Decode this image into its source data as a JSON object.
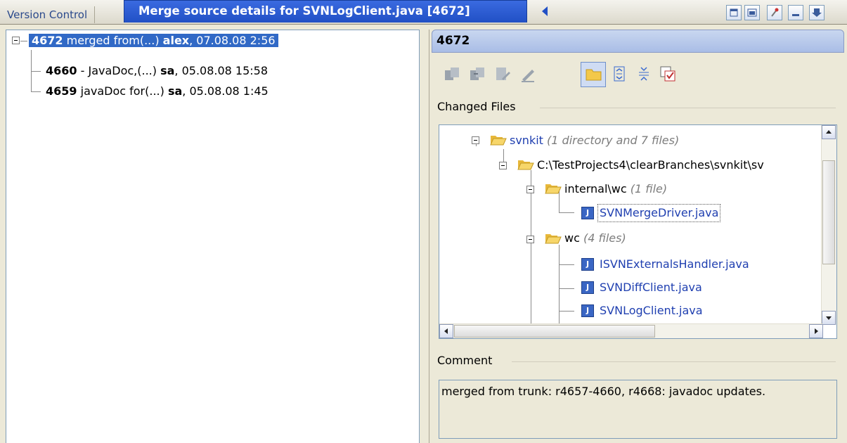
{
  "tabs": {
    "inactive_label": "Version Control",
    "active_label": "Merge source details for SVNLogClient.java [4672]"
  },
  "left_tree": {
    "root": {
      "rev": "4672",
      "msg": " merged from(...) ",
      "author": "alex",
      "date": ", 07.08.08 2:56"
    },
    "children": [
      {
        "rev": "4660",
        "msg": " - JavaDoc,(...) ",
        "author": "sa",
        "date": ", 05.08.08 15:58"
      },
      {
        "rev": "4659",
        "msg": " javaDoc for(...) ",
        "author": "sa",
        "date": ", 05.08.08 1:45"
      }
    ]
  },
  "details": {
    "header": "4672",
    "changed_files_label": "Changed Files",
    "comment_label": "Comment",
    "comment_text": "merged from trunk: r4657-4660, r4668: javadoc updates."
  },
  "file_tree": {
    "svnkit": {
      "name": "svnkit",
      "info": "(1 directory and 7 files)"
    },
    "path": {
      "name": "C:\\TestProjects4\\clearBranches\\svnkit\\sv"
    },
    "internal": {
      "name": "internal\\wc",
      "info": "(1 file)"
    },
    "merge_driver": "SVNMergeDriver.java",
    "wc": {
      "name": "wc",
      "info": "(4 files)"
    },
    "wc_files": [
      "ISVNExternalsHandler.java",
      "SVNDiffClient.java",
      "SVNLogClient.java"
    ]
  },
  "colors": {
    "selection": "#3169c6",
    "tab_active": "#2150c5",
    "link": "#1f3fb0"
  }
}
